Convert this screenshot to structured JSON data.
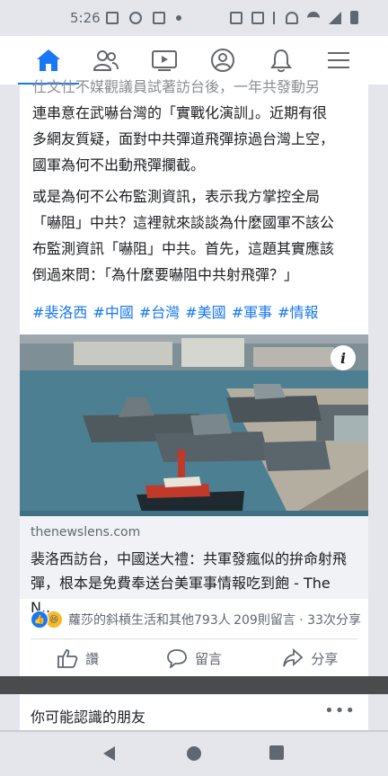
{
  "status_bar": {
    "time": "5:26"
  },
  "nav": {
    "items": [
      "home",
      "friends",
      "watch",
      "profile",
      "notifications",
      "menu"
    ]
  },
  "post": {
    "top_lines": [
      "仕文仕不媒觀議員試著訪台後，一年共發動另",
      "連串意在武嚇台灣的「實戰化演訓」。近期有很",
      "多網友質疑，面對中共彈道飛彈掠過台灣上空，",
      "國軍為何不出動飛彈攔截。"
    ],
    "para2_lines": [
      "或是為何不公布監測資訊，表示我方掌控全局",
      "「嚇阻」中共？這裡就來談談為什麼國軍不該公",
      "布監測資訊「嚇阻」中共。首先，這題其實應該",
      "倒過來問：「為什麼要嚇阻中共射飛彈？」"
    ],
    "hashtags": [
      "#裴洛西",
      "#中國",
      "#台灣",
      "#美國",
      "#軍事",
      "#情報"
    ],
    "link": {
      "domain": "thenewslens.com",
      "title_line1": "裴洛西訪台，中國送大禮：共軍發瘋似的拚命射飛",
      "title_line2": "彈，根本是免費奉送台美軍事情報吃到飽 - The N..."
    },
    "reactions": {
      "names": "蘿莎的斜槓生活和其他793人",
      "stats": "209則留言 · 33次分享"
    },
    "actions": {
      "like": "讚",
      "comment": "留言",
      "share": "分享"
    }
  },
  "pymk": {
    "title": "你可能認識的朋友",
    "more": "•••"
  },
  "colors": {
    "accent": "#1877f2",
    "text": "#1c1e21",
    "secondary": "#606770"
  }
}
